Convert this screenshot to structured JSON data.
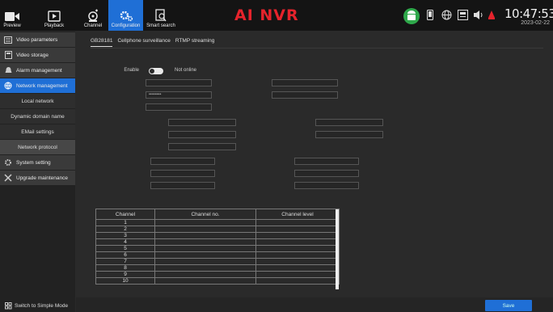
{
  "topbar": {
    "nav": [
      {
        "label": "Preview",
        "icon": "camera-icon"
      },
      {
        "label": "Playback",
        "icon": "playback-icon"
      },
      {
        "label": "Channel",
        "icon": "channel-icon"
      },
      {
        "label": "Configuration",
        "icon": "gear-icon",
        "active": true
      },
      {
        "label": "Smart search",
        "icon": "search-document-icon"
      }
    ],
    "brand": "AI NVR",
    "time": "10:47:53",
    "date": "2023-02-22",
    "brand_color": "#e6232c",
    "accent_color": "#1f6fd6"
  },
  "sidebar": {
    "items": [
      {
        "label": "Video parameters",
        "icon": "video-params-icon"
      },
      {
        "label": "Video storage",
        "icon": "storage-icon"
      },
      {
        "label": "Alarm management",
        "icon": "bell-icon"
      },
      {
        "label": "Network management",
        "icon": "network-icon",
        "active": true
      }
    ],
    "sub_items": [
      {
        "label": "Local network"
      },
      {
        "label": "Dynamic domain name"
      },
      {
        "label": "EMail settings"
      },
      {
        "label": "Network protocol",
        "active": true
      }
    ],
    "items_after": [
      {
        "label": "System setting",
        "icon": "gear-icon"
      },
      {
        "label": "Upgrade maintenance",
        "icon": "wrench-icon"
      }
    ],
    "simple_mode": "Switch to Simple Mode"
  },
  "tabs": [
    "GB28181",
    "Cellphone surveillance",
    "RTMP streaming"
  ],
  "form": {
    "enable_label": "Enable",
    "status": "Not online",
    "password_mask": "••••••••"
  },
  "table": {
    "headers": [
      "Channel",
      "Channel no.",
      "Channel level"
    ],
    "rows": [
      "1",
      "2",
      "3",
      "4",
      "5",
      "6",
      "7",
      "8",
      "9",
      "10"
    ]
  },
  "save_label": "Save"
}
